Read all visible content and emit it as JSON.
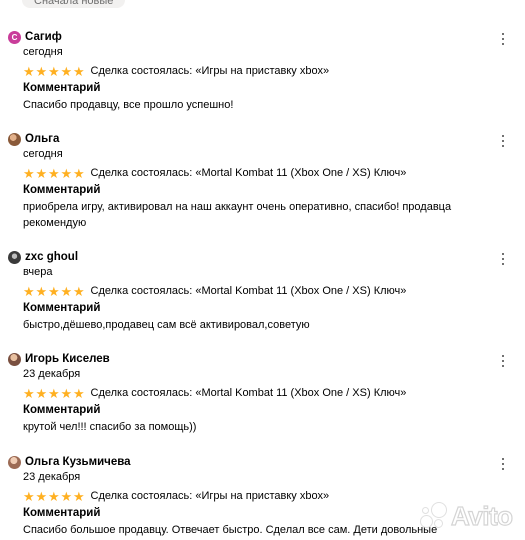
{
  "sort_chip": {
    "label": "Сначала новые"
  },
  "reviews": [
    {
      "author": "Сагиф",
      "avatar": {
        "initial": "С",
        "color": "#c93d9a"
      },
      "date": "сегодня",
      "rating": 5,
      "deal": "Сделка состоялась: «Игры на приставку xbox»",
      "comment_label": "Комментарий",
      "comment": "Спасибо продавцу, все прошло успешно!"
    },
    {
      "author": "Ольга",
      "avatar": {
        "initial": "",
        "color": "#8a5a3a"
      },
      "date": "сегодня",
      "rating": 5,
      "deal": "Сделка состоялась: «Mortal Kombat 11 (Xbox One / XS) Ключ»",
      "comment_label": "Комментарий",
      "comment": "приобрела игру, активировал на наш аккаунт очень оперативно, спасибо! продавца рекомендую"
    },
    {
      "author": "zxc ghoul",
      "avatar": {
        "initial": "",
        "color": "#3a3a3a"
      },
      "date": "вчера",
      "rating": 5,
      "deal": "Сделка состоялась: «Mortal Kombat 11 (Xbox One / XS) Ключ»",
      "comment_label": "Комментарий",
      "comment": "быстро,дёшево,продавец сам всё активировал,советую"
    },
    {
      "author": "Игорь Киселев",
      "avatar": {
        "initial": "",
        "color": "#7a5040"
      },
      "date": "23 декабря",
      "rating": 5,
      "deal": "Сделка состоялась: «Mortal Kombat 11 (Xbox One / XS) Ключ»",
      "comment_label": "Комментарий",
      "comment": "крутой чел!!! спасибо за помощь))"
    },
    {
      "author": "Ольга Кузьмичева",
      "avatar": {
        "initial": "",
        "color": "#9c6b55"
      },
      "date": "23 декабря",
      "rating": 5,
      "deal": "Сделка состоялась: «Игры на приставку xbox»",
      "comment_label": "Комментарий",
      "comment": "Спасибо большое продавцу. Отвечает быстро. Сделал все сам. Дети довольные"
    }
  ],
  "colors": {
    "star": "#ffb021",
    "text": "#000000",
    "chip_bg": "#f2f1f0"
  },
  "icons": {
    "star": "star-icon",
    "more": "more-vertical-icon"
  },
  "watermark": {
    "text": "Avito"
  }
}
